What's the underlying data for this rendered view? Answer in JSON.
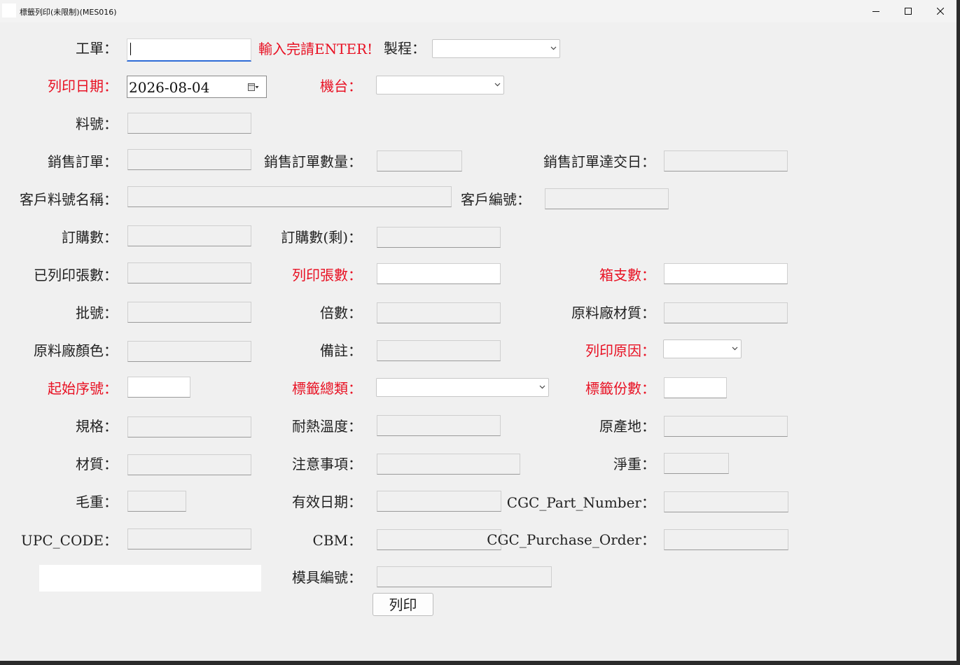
{
  "window": {
    "title": "標籤列印(未限制)(MES016)"
  },
  "hint_text": "輸入完請ENTER!",
  "labels": {
    "work_order": "工單：",
    "process": "製程：",
    "print_date": "列印日期：",
    "machine": "機台：",
    "part_no": "料號：",
    "sales_order": "銷售訂單：",
    "sales_order_qty": "銷售訂單數量：",
    "sales_order_due": "銷售訂單達交日：",
    "customer_part_name": "客戶料號名稱：",
    "customer_no": "客戶編號：",
    "order_qty": "訂購數：",
    "order_qty_remain": "訂購數(剩)：",
    "printed_count": "已列印張數：",
    "print_count": "列印張數：",
    "box_count": "箱支數：",
    "lot_no": "批號：",
    "multiple": "倍數：",
    "raw_material": "原料廠材質：",
    "raw_color": "原料廠顏色：",
    "remark": "備註：",
    "print_reason": "列印原因：",
    "start_serial": "起始序號：",
    "label_type": "標籤總類：",
    "label_copies": "標籤份數：",
    "spec": "規格：",
    "heat_temp": "耐熱溫度：",
    "origin": "原產地：",
    "material": "材質：",
    "caution": "注意事項：",
    "net_weight": "淨重：",
    "gross_weight": "毛重：",
    "expiry_date": "有效日期：",
    "cgc_part_number": "CGC_Part_Number：",
    "upc_code": "UPC_CODE：",
    "cbm": "CBM：",
    "cgc_purchase_order": "CGC_Purchase_Order：",
    "mold_no": "模具編號："
  },
  "values": {
    "print_date": "2026-08-04"
  },
  "buttons": {
    "print": "列印"
  },
  "colors": {
    "required_label": "#e81123",
    "focus_underline": "#2e6bd6"
  },
  "icons": {
    "minimize": "minimize-icon",
    "maximize": "maximize-icon",
    "close": "close-icon",
    "dropdown": "chevron-down-icon",
    "calendar": "calendar-icon"
  }
}
